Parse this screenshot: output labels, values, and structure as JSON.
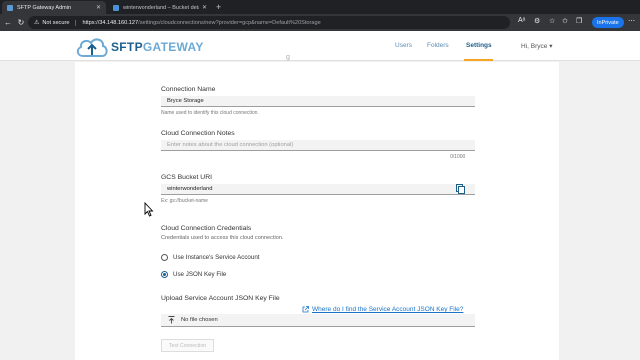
{
  "browser": {
    "tabs": [
      {
        "title": "SFTP Gateway Admin",
        "active": true
      },
      {
        "title": "winterwonderland – Bucket detai",
        "active": false
      }
    ],
    "new_tab": "+",
    "security_label": "Not secure",
    "url_host": "https://34.148.160.127",
    "url_path": "/settings/cloudconnections/new?provider=gcp&name=Default%20Storage",
    "inprivate_label": "InPrivate"
  },
  "app": {
    "logo_part1": "SFTP",
    "logo_part2": "GATEWAY",
    "nav": {
      "users": "Users",
      "folders": "Folders",
      "settings": "Settings"
    },
    "user_greeting": "Hi, Bryce",
    "accent": "#f5a623",
    "brand": "#1c5f8c"
  },
  "form": {
    "section_title_fragment": "g",
    "connection_name": {
      "label": "Connection Name",
      "value": "Bryce Storage",
      "help": "Name used to identify this cloud connection."
    },
    "notes": {
      "label": "Cloud Connection Notes",
      "placeholder": "Enter notes about the cloud connection (optional)",
      "counter": "0/1000"
    },
    "bucket": {
      "label": "GCS Bucket URI",
      "value": "winterwonderland",
      "help": "Ex: gs://bucket-name"
    },
    "credentials": {
      "label": "Cloud Connection Credentials",
      "help": "Credentials used to access this cloud connection.",
      "options": [
        {
          "label": "Use Instance's Service Account",
          "selected": false
        },
        {
          "label": "Use JSON Key File",
          "selected": true
        }
      ]
    },
    "upload": {
      "label": "Upload Service Account JSON Key File",
      "file_status": "No file chosen",
      "help_link": "Where do I find the Service Account JSON Key File?"
    },
    "test_button": "Test Connection"
  }
}
